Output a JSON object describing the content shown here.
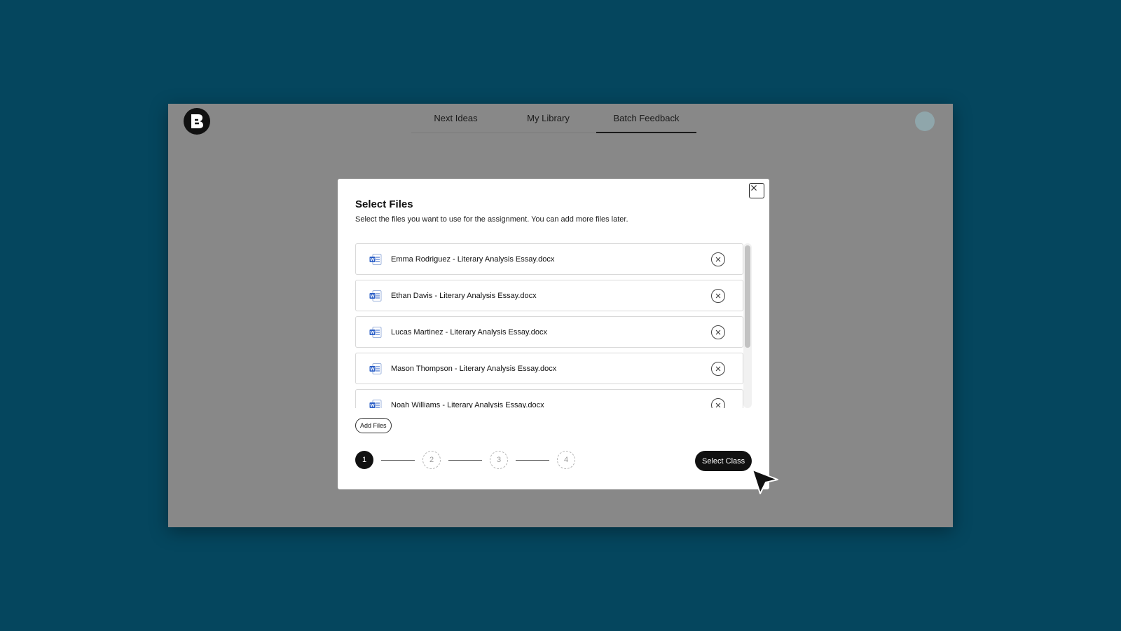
{
  "nav": {
    "tabs": [
      {
        "label": "Next Ideas"
      },
      {
        "label": "My Library"
      },
      {
        "label": "Batch Feedback",
        "active": true
      }
    ]
  },
  "modal": {
    "title": "Select Files",
    "subtitle": "Select the files you want to use for the assignment. You can add more files later.",
    "files": [
      {
        "name": "Emma Rodriguez - Literary Analysis Essay.docx",
        "icon": "word-doc-icon"
      },
      {
        "name": "Ethan Davis - Literary Analysis Essay.docx",
        "icon": "word-doc-icon"
      },
      {
        "name": "Lucas Martinez - Literary Analysis Essay.docx",
        "icon": "word-doc-icon"
      },
      {
        "name": "Mason Thompson - Literary Analysis Essay.docx",
        "icon": "word-doc-icon"
      },
      {
        "name": "Noah Williams - Literary Analysis Essay.docx",
        "icon": "word-doc-icon"
      }
    ],
    "add_files_label": "Add Files",
    "steps": [
      "1",
      "2",
      "3",
      "4"
    ],
    "current_step": 1,
    "primary_button": "Select Class"
  },
  "colors": {
    "background": "#05465e",
    "overlay": "#888888",
    "primary": "#111111",
    "word_blue": "#2b5fc7"
  }
}
